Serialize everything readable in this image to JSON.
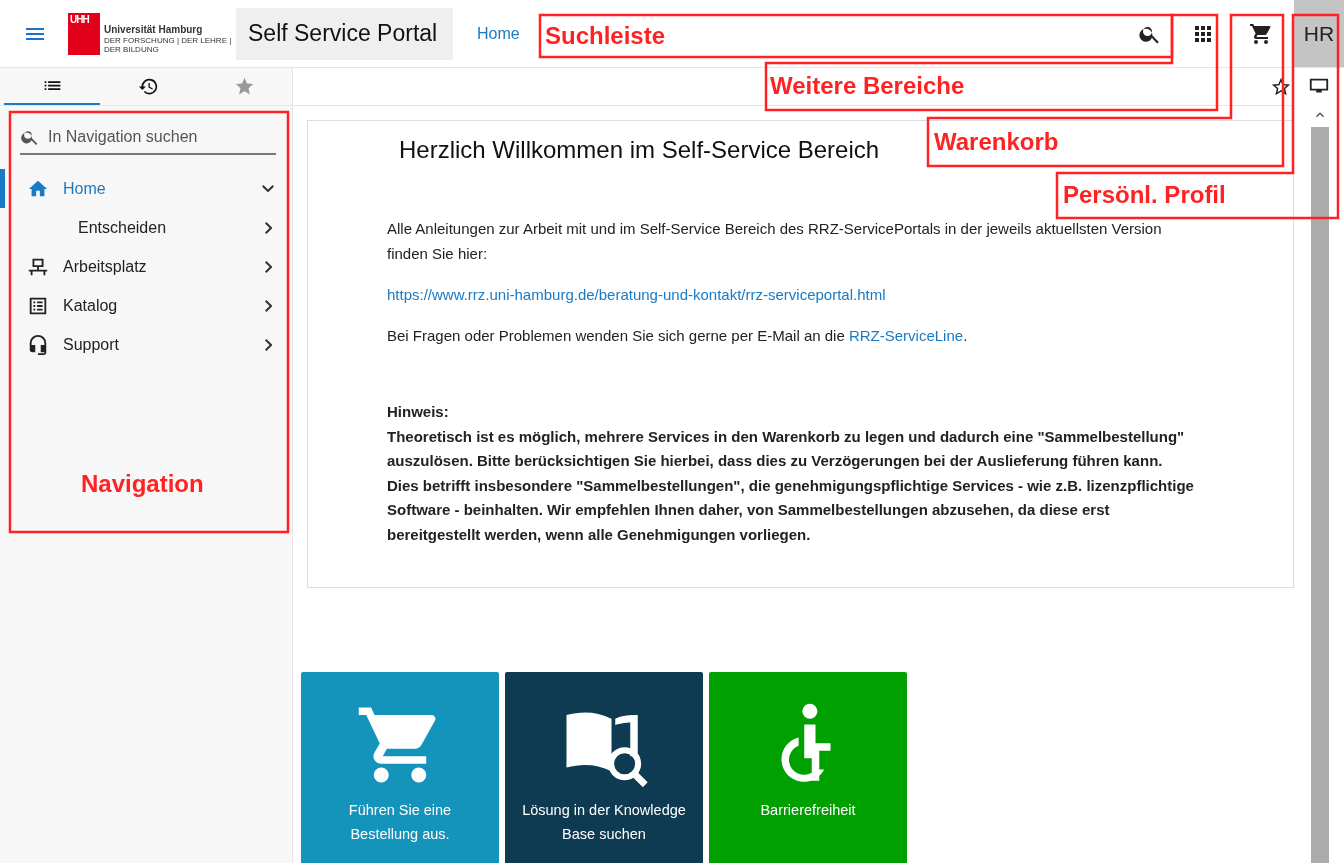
{
  "header": {
    "logo_mark": "UHH",
    "brand": "Universität Hamburg",
    "tagline": "DER FORSCHUNG | DER LEHRE | DER BILDUNG",
    "title": "Self Service Portal",
    "breadcrumb": "Home",
    "avatar": "HR"
  },
  "sidebar": {
    "tabs": [
      {
        "kind": "list",
        "selected": true,
        "disabled": false
      },
      {
        "kind": "history",
        "selected": false,
        "disabled": false
      },
      {
        "kind": "favorites",
        "selected": false,
        "disabled": true
      }
    ],
    "search": {
      "placeholder": "In Navigation suchen"
    },
    "items": [
      {
        "label": "Home",
        "kind": "home",
        "selected": true,
        "expanded": true,
        "children": [
          {
            "label": "Entscheiden",
            "selected": false,
            "expanded": false
          }
        ]
      },
      {
        "label": "Arbeitsplatz",
        "kind": "workstation",
        "selected": false,
        "expanded": false
      },
      {
        "label": "Katalog",
        "kind": "catalog",
        "selected": false,
        "expanded": false
      },
      {
        "label": "Support",
        "kind": "headset",
        "selected": false,
        "expanded": false
      }
    ]
  },
  "content": {
    "title": "Herzlich Willkommen im Self-Service Bereich",
    "intro": "Alle Anleitungen zur Arbeit mit und im Self-Service Bereich des RRZ-ServicePortals in der jeweils aktuellsten Version finden Sie hier:",
    "link": "https://www.rrz.uni-hamburg.de/beratung-und-kontakt/rrz-serviceportal.html",
    "contact": {
      "before": "Bei Fragen oder Problemen wenden Sie sich gerne per E-Mail an die ",
      "link": "RRZ-ServiceLine",
      "after": "."
    },
    "note_heading": "Hinweis:",
    "note": "Theoretisch ist es möglich, mehrere Services in den Warenkorb zu legen und dadurch eine \"Sammelbestellung\" auszulösen. Bitte berücksichtigen Sie hierbei, dass dies zu Verzögerungen bei der Auslieferung führen kann. Dies betrifft insbesondere \"Sammelbestellungen\", die genehmigungspflichtige Services - wie z.B. lizenzpflichtige Software - beinhalten. Wir empfehlen Ihnen daher, von Sammelbestellungen abzusehen, da diese erst bereitgestellt werden, wenn alle Genehmigungen vorliegen."
  },
  "tiles": [
    {
      "label": "Führen Sie eine Bestellung aus.",
      "kind": "cart",
      "color": "#1493bb"
    },
    {
      "label": "Lösung in der Knowledge Base suchen",
      "kind": "book",
      "color": "#0e3a52"
    },
    {
      "label": "Barrierefreiheit",
      "kind": "accessibility",
      "color": "#00a000"
    }
  ],
  "annotations": [
    {
      "label": "Suchleiste",
      "kind": "search"
    },
    {
      "label": "Weitere Bereiche",
      "kind": "areas"
    },
    {
      "label": "Warenkorb",
      "kind": "cart"
    },
    {
      "label": "Persönl. Profil",
      "kind": "profile"
    },
    {
      "label": "Navigation",
      "kind": "navigation"
    }
  ]
}
